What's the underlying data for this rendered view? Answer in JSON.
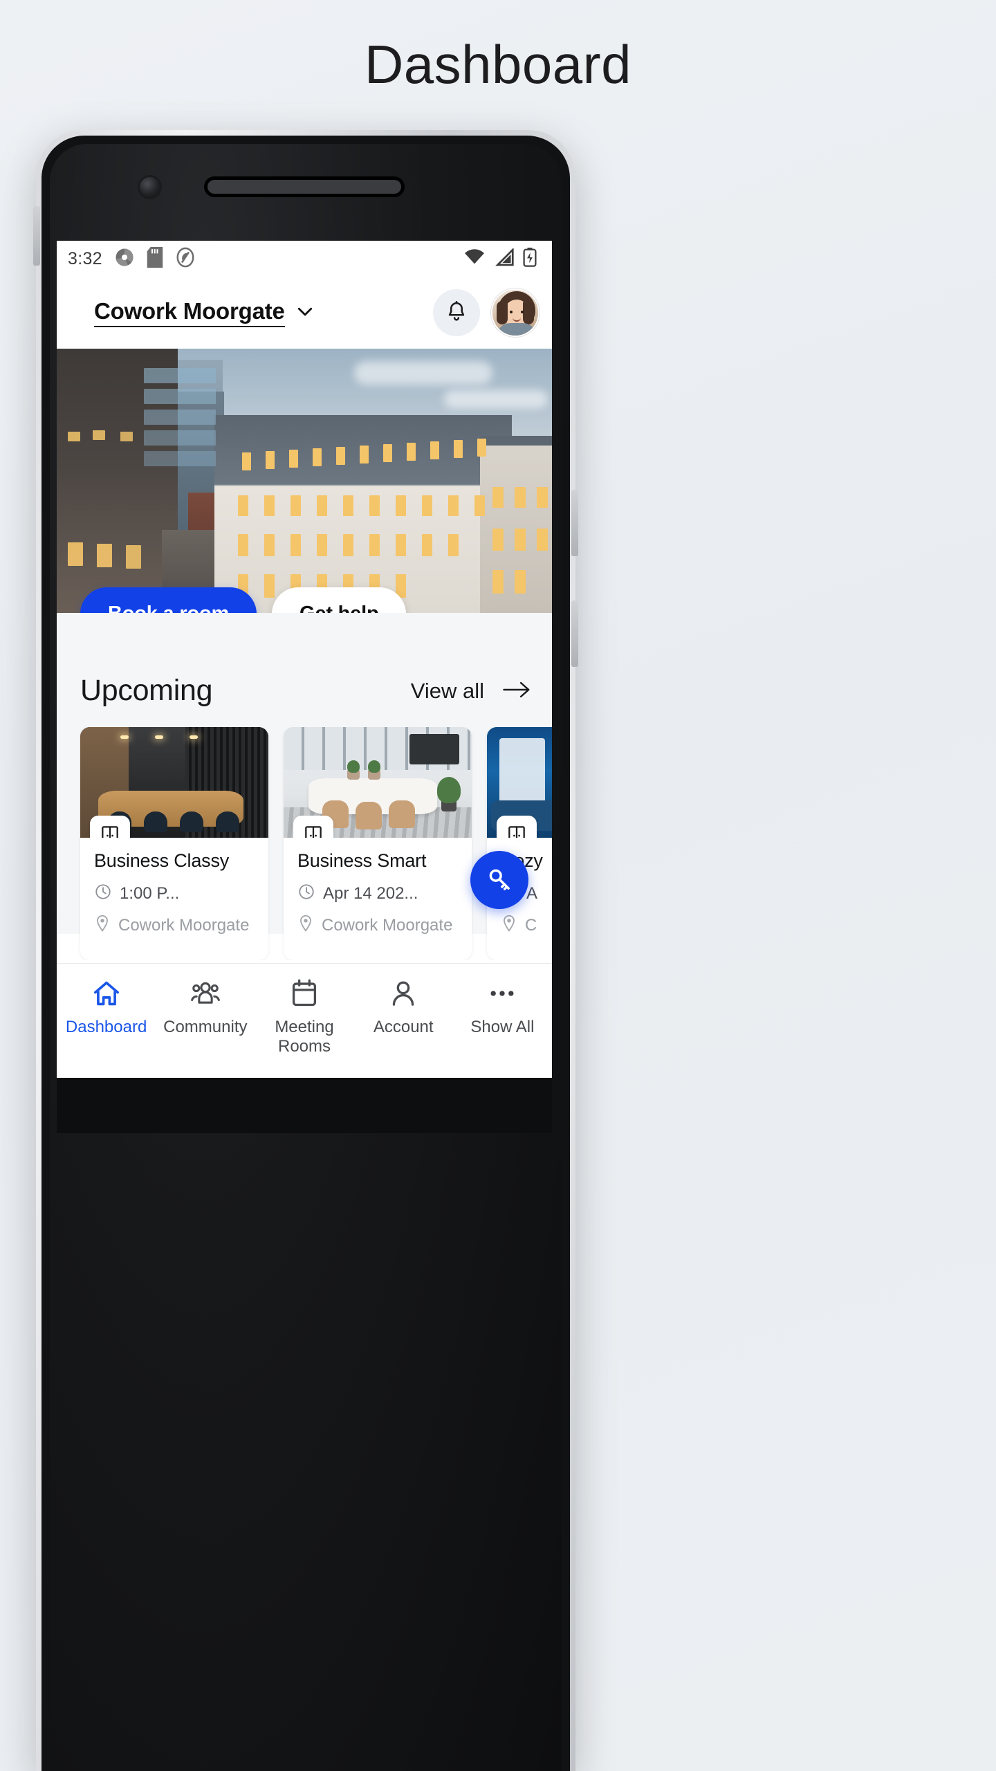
{
  "page": {
    "title": "Dashboard"
  },
  "statusbar": {
    "time": "3:32",
    "left_icons": [
      "camera-aperture-icon",
      "sd-card-icon",
      "aperture-outline-icon"
    ],
    "right_icons": [
      "wifi-icon",
      "cellular-signal-icon",
      "battery-charging-icon"
    ]
  },
  "header": {
    "venue_name": "Cowork Moorgate",
    "chevron_icon": "chevron-down-icon",
    "bell_icon": "bell-icon",
    "avatar_alt": "user-avatar"
  },
  "hero": {
    "alt": "aerial-view-of-city-office-buildings",
    "primary_cta": "Book a room",
    "secondary_cta": "Get help"
  },
  "upcoming": {
    "title": "Upcoming",
    "view_all_label": "View all",
    "view_all_icon": "arrow-right-icon",
    "cards": [
      {
        "name": "Business Classy",
        "time": "1:00 P...",
        "location": "Cowork Moorgate",
        "clock_icon": "clock-icon",
        "pin_icon": "map-pin-icon",
        "badge_icon": "door-icon"
      },
      {
        "name": "Business Smart",
        "time": "Apr 14 202...",
        "location": "Cowork Moorgate",
        "clock_icon": "clock-icon",
        "pin_icon": "map-pin-icon",
        "badge_icon": "door-icon"
      },
      {
        "name": "Cozy",
        "time": "A",
        "location": "C",
        "clock_icon": "clock-icon",
        "pin_icon": "map-pin-icon",
        "badge_icon": "door-icon"
      }
    ]
  },
  "fab": {
    "icon": "key-icon"
  },
  "bottom_nav": {
    "items": [
      {
        "label": "Dashboard",
        "icon": "home-icon",
        "active": true
      },
      {
        "label": "Community",
        "icon": "people-icon",
        "active": false
      },
      {
        "label": "Meeting\nRooms",
        "icon": "calendar-icon",
        "active": false
      },
      {
        "label": "Account",
        "icon": "person-icon",
        "active": false
      },
      {
        "label": "Show All",
        "icon": "ellipsis-icon",
        "active": false
      }
    ]
  },
  "colors": {
    "accent_blue": "#1241e8",
    "nav_active": "#1a56e8",
    "page_bg": "#eef1f4",
    "content_bg": "#f4f6f8",
    "text_primary": "#121315",
    "text_muted": "#9a9da2"
  }
}
